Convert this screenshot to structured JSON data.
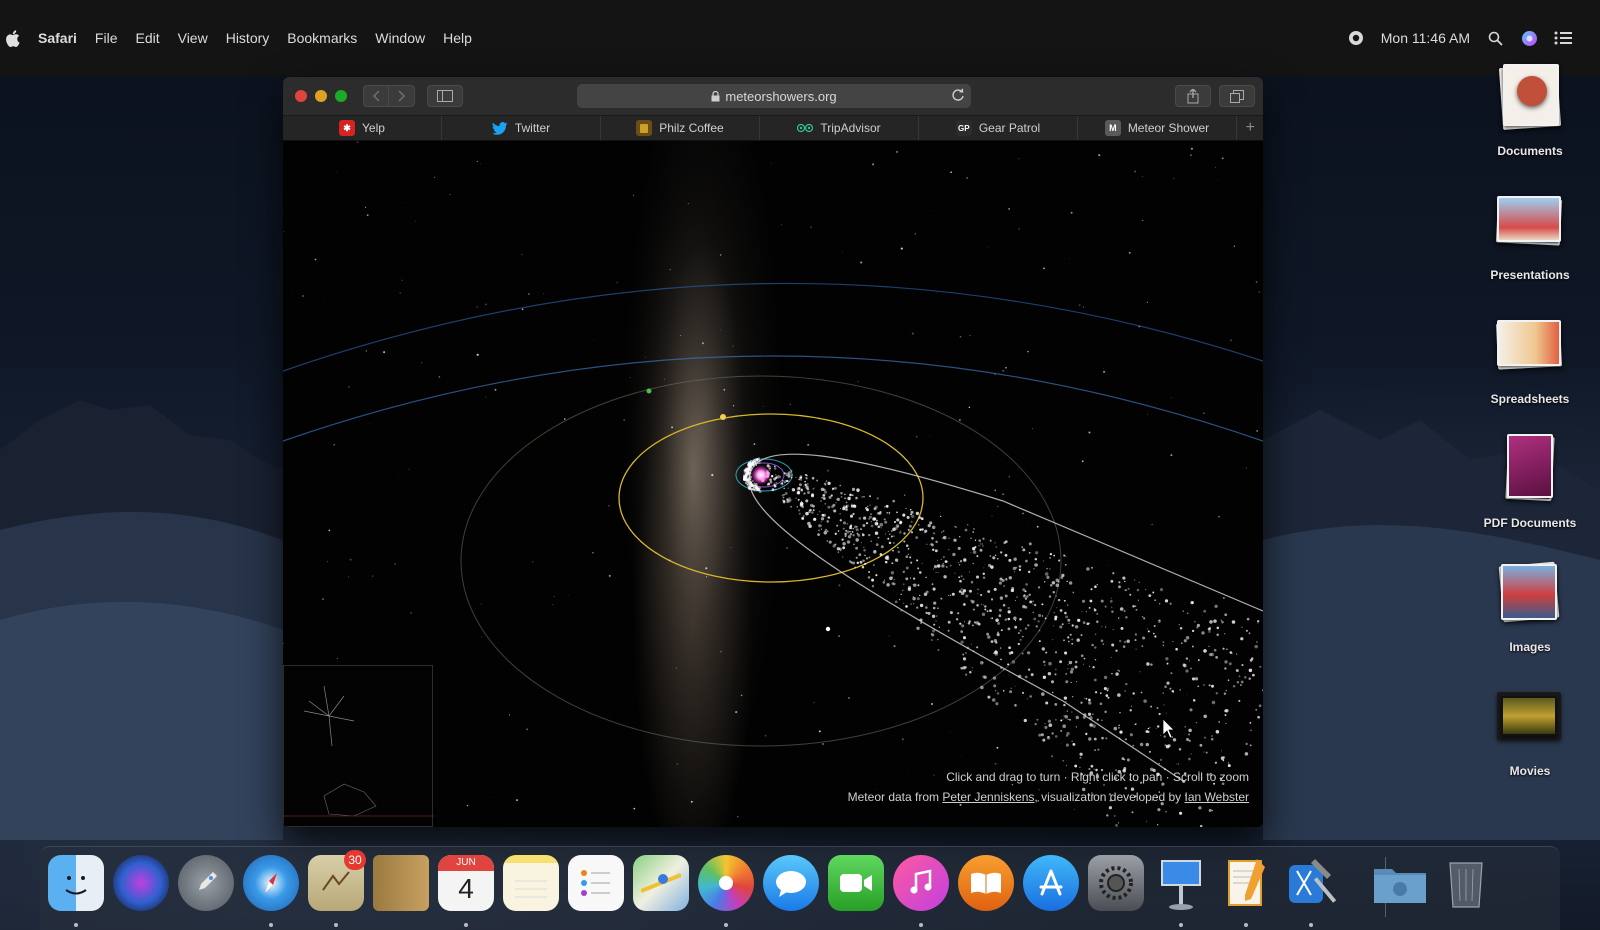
{
  "menubar": {
    "app_name": "Safari",
    "menus": [
      "File",
      "Edit",
      "View",
      "History",
      "Bookmarks",
      "Window",
      "Help"
    ],
    "clock": "Mon 11:46 AM"
  },
  "browser": {
    "url": "meteorshowers.org",
    "favorites": [
      {
        "label": "Yelp",
        "icon": "yelp-icon",
        "color": "#d32323"
      },
      {
        "label": "Twitter",
        "icon": "twitter-icon",
        "color": "#1da1f2"
      },
      {
        "label": "Philz Coffee",
        "icon": "philz-coffee-icon",
        "color": "#c9a227"
      },
      {
        "label": "TripAdvisor",
        "icon": "tripadvisor-icon",
        "color": "#34e0a1"
      },
      {
        "label": "Gear Patrol",
        "icon": "gear-patrol-icon",
        "color": "#555555"
      },
      {
        "label": "Meteor Shower",
        "icon": "meteor-shower-icon",
        "color": "#666666"
      }
    ],
    "favorites_letters": {
      "gear_patrol": "GP",
      "meteor_shower": "M"
    },
    "page": {
      "hint_line1": "Click and drag to turn · Right click to pan · Scroll to zoom",
      "hint_line2_prefix": "Meteor data from ",
      "hint_link1": "Peter Jenniskens",
      "hint_line2_middle": ", visualization developed by ",
      "hint_link2": "Ian Webster"
    }
  },
  "desktop_stacks": [
    {
      "label": "Documents"
    },
    {
      "label": "Presentations"
    },
    {
      "label": "Spreadsheets"
    },
    {
      "label": "PDF Documents"
    },
    {
      "label": "Images"
    },
    {
      "label": "Movies"
    }
  ],
  "dock": {
    "items": [
      "Finder",
      "Siri",
      "Launchpad",
      "Safari",
      "Mail",
      "Notes Book",
      "Calendar",
      "Notes",
      "Reminders",
      "Maps",
      "Photos",
      "Messages",
      "FaceTime",
      "iTunes",
      "iBooks",
      "App Store",
      "System Preferences",
      "Keynote",
      "Pages",
      "Xcode",
      "Downloads",
      "Trash"
    ],
    "mail_badge": "30",
    "calendar_month": "JUN",
    "calendar_day": "4"
  },
  "colors": {
    "menubar_bg": "#141414",
    "window_toolbar": "#2c2c2c",
    "orbit_yellow": "#d8b72a",
    "orbit_blue": "#3a6fae"
  }
}
